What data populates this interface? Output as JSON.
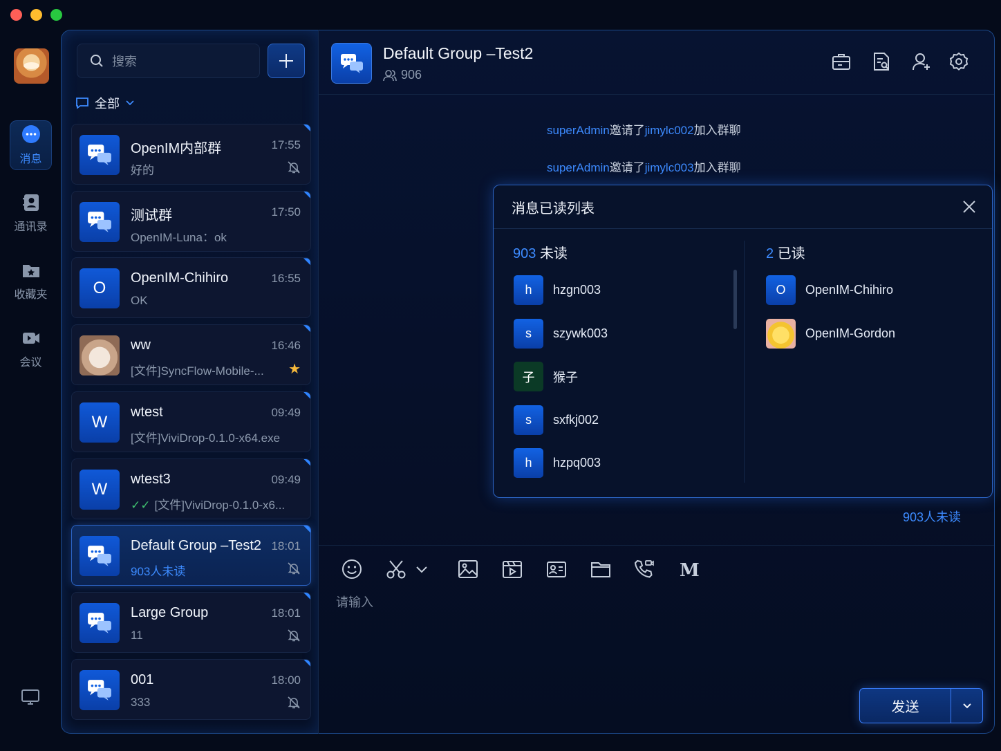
{
  "nav": {
    "items": [
      {
        "label": "消息",
        "icon": "chat-bubble-icon"
      },
      {
        "label": "通讯录",
        "icon": "contacts-icon"
      },
      {
        "label": "收藏夹",
        "icon": "folder-star-icon"
      },
      {
        "label": "会议",
        "icon": "video-icon"
      }
    ]
  },
  "list": {
    "search_placeholder": "搜索",
    "filter_label": "全部",
    "conversations": [
      {
        "name": "OpenIM内部群",
        "time": "17:55",
        "preview": "好的",
        "avatar": "group",
        "muted": true
      },
      {
        "name": "测试群",
        "time": "17:50",
        "preview": "OpenIM-Luna：ok",
        "avatar": "group",
        "muted": false
      },
      {
        "name": "OpenIM-Chihiro",
        "time": "16:55",
        "preview": "OK",
        "avatar": "O",
        "muted": false
      },
      {
        "name": "ww",
        "time": "16:46",
        "preview": "[文件]SyncFlow-Mobile-...",
        "avatar": "photo",
        "starred": true
      },
      {
        "name": "wtest",
        "time": "09:49",
        "preview": "[文件]ViviDrop-0.1.0-x64.exe",
        "avatar": "W",
        "muted": false
      },
      {
        "name": "wtest3",
        "time": "09:49",
        "preview": "[文件]ViviDrop-0.1.0-x6...",
        "avatar": "W",
        "read_check": true
      },
      {
        "name": "Default Group –Test2",
        "time": "18:01",
        "preview": "903人未读",
        "avatar": "group",
        "muted": true,
        "active": true
      },
      {
        "name": "Large Group",
        "time": "18:01",
        "preview": "11",
        "avatar": "group",
        "muted": true
      },
      {
        "name": "001",
        "time": "18:00",
        "preview": "333",
        "avatar": "group",
        "muted": true
      }
    ]
  },
  "chat": {
    "title": "Default Group –Test2",
    "member_count": "906",
    "system_messages": [
      {
        "actor": "superAdmin",
        "verb": "邀请了",
        "target": "jimylc002",
        "suffix": "加入群聊"
      },
      {
        "actor": "superAdmin",
        "verb": "邀请了",
        "target": "jimylc003",
        "suffix": "加入群聊"
      }
    ],
    "unread_link": "903人未读",
    "composer_placeholder": "请输入",
    "send_label": "发送"
  },
  "read_popup": {
    "title": "消息已读列表",
    "unread_count": "903",
    "unread_label": "未读",
    "read_count": "2",
    "read_label": "已读",
    "unread_members": [
      {
        "initial": "h",
        "name": "hzgn003"
      },
      {
        "initial": "s",
        "name": "szywk003"
      },
      {
        "initial": "子",
        "name": "猴子"
      },
      {
        "initial": "s",
        "name": "sxfkj002"
      },
      {
        "initial": "h",
        "name": "hzpq003"
      }
    ],
    "read_members": [
      {
        "initial": "O",
        "name": "OpenIM-Chihiro"
      },
      {
        "initial": "",
        "name": "OpenIM-Gordon"
      }
    ]
  },
  "colors": {
    "accent": "#3d8bff",
    "background": "#050b1a",
    "border_glow": "#1c4a8d"
  }
}
